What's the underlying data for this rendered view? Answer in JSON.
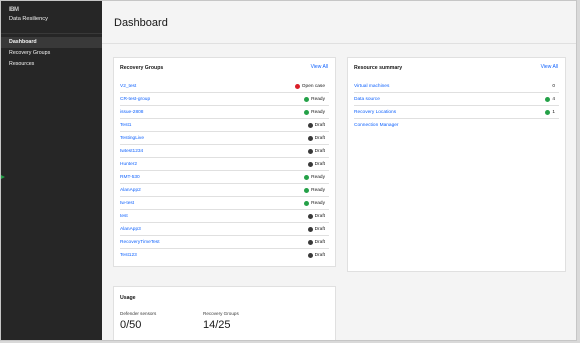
{
  "app": {
    "logo_text": "IBM",
    "name": "Data Resiliency"
  },
  "nav": {
    "items": [
      {
        "label": "Dashboard",
        "active": true
      },
      {
        "label": "Recovery Groups",
        "active": false
      },
      {
        "label": "Resources",
        "active": false
      }
    ]
  },
  "page": {
    "title": "Dashboard"
  },
  "recovery_groups": {
    "title": "Recovery Groups",
    "view_all": "View All",
    "rows": [
      {
        "name": "V2_test",
        "status": "Open case",
        "color": "#da1e28"
      },
      {
        "name": "CR-test-group",
        "status": "Ready",
        "color": "#24a148"
      },
      {
        "name": "issue-2808",
        "status": "Ready",
        "color": "#24a148"
      },
      {
        "name": "Test1",
        "status": "Draft",
        "color": "#393939"
      },
      {
        "name": "TestingLive",
        "status": "Draft",
        "color": "#393939"
      },
      {
        "name": "twtest1234",
        "status": "Draft",
        "color": "#393939"
      },
      {
        "name": "Hunter2",
        "status": "Draft",
        "color": "#393939"
      },
      {
        "name": "RMT-530",
        "status": "Ready",
        "color": "#24a148"
      },
      {
        "name": "AlanApp2",
        "status": "Ready",
        "color": "#24a148"
      },
      {
        "name": "tw-test",
        "status": "Ready",
        "color": "#24a148"
      },
      {
        "name": "test",
        "status": "Draft",
        "color": "#393939"
      },
      {
        "name": "AlanApp3",
        "status": "Draft",
        "color": "#393939"
      },
      {
        "name": "RecoveryTimeTest",
        "status": "Draft",
        "color": "#393939"
      },
      {
        "name": "Test123",
        "status": "Draft",
        "color": "#393939"
      }
    ]
  },
  "resource_summary": {
    "title": "Resource summary",
    "view_all": "View All",
    "rows": [
      {
        "name": "Virtual machines",
        "value": "0",
        "color": ""
      },
      {
        "name": "Data source",
        "value": "4",
        "color": "#24a148"
      },
      {
        "name": "Recovery Locations",
        "value": "1",
        "color": "#24a148"
      },
      {
        "name": "Connection Manager",
        "value": "",
        "color": ""
      }
    ]
  },
  "usage": {
    "title": "Usage",
    "metrics": [
      {
        "label": "Defender sensors",
        "value": "0/50"
      },
      {
        "label": "Recovery Groups",
        "value": "14/25"
      }
    ]
  }
}
